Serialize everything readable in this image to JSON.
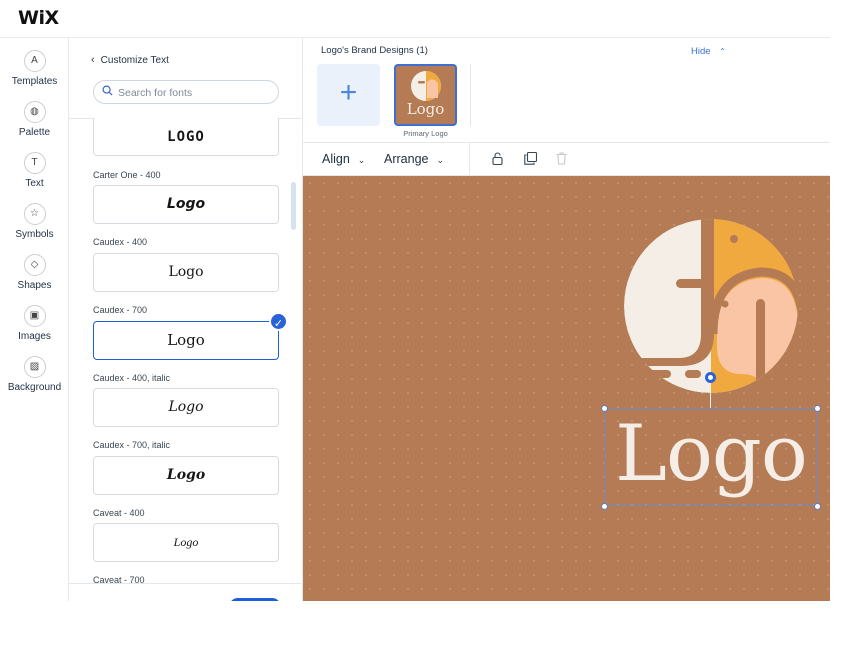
{
  "app": {
    "brand": "WiX"
  },
  "sidebar": {
    "items": [
      {
        "label": "Templates",
        "icon": "templates-icon",
        "glyph": "A"
      },
      {
        "label": "Palette",
        "icon": "palette-icon",
        "glyph": "◍"
      },
      {
        "label": "Text",
        "icon": "text-icon",
        "glyph": "T"
      },
      {
        "label": "Symbols",
        "icon": "star-icon",
        "glyph": "☆"
      },
      {
        "label": "Shapes",
        "icon": "shapes-icon",
        "glyph": "◇"
      },
      {
        "label": "Images",
        "icon": "image-icon",
        "glyph": "▣"
      },
      {
        "label": "Background",
        "icon": "background-icon",
        "glyph": "▨"
      }
    ]
  },
  "panel": {
    "back_label": "Customize Text",
    "search": {
      "placeholder": "Search for fonts",
      "value": ""
    },
    "fonts": [
      {
        "label": "",
        "preview": "LOGO",
        "selected": false
      },
      {
        "label": "Carter One - 400",
        "preview": "Logo",
        "selected": false
      },
      {
        "label": "Caudex - 400",
        "preview": "Logo",
        "selected": false
      },
      {
        "label": "Caudex - 700",
        "preview": "Logo",
        "selected": true
      },
      {
        "label": "Caudex - 400, italic",
        "preview": "Logo",
        "selected": false
      },
      {
        "label": "Caudex - 700, italic",
        "preview": "Logo",
        "selected": false
      },
      {
        "label": "Caveat - 400",
        "preview": "Logo",
        "selected": false
      },
      {
        "label": "Caveat - 700",
        "preview": "",
        "selected": false
      }
    ]
  },
  "brand_designs": {
    "title": "Logo's Brand Designs (1)",
    "hide_label": "Hide",
    "add_symbol": "+",
    "tile_word": "Logo",
    "tile_caption": "Primary Logo"
  },
  "toolbar": {
    "align_label": "Align",
    "arrange_label": "Arrange"
  },
  "canvas": {
    "logo_text": "Logo"
  },
  "colors": {
    "accent": "#2a63d8",
    "canvas_bg": "#b47b54",
    "logo_cream": "#f4eee6",
    "logo_orange": "#f0a93e",
    "logo_peach": "#f9c5a4"
  }
}
